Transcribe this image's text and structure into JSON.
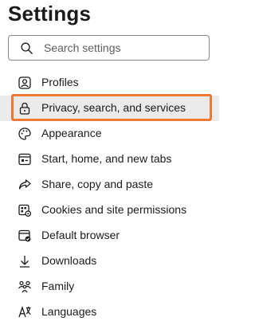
{
  "title": "Settings",
  "search": {
    "placeholder": "Search settings",
    "value": ""
  },
  "nav_items": [
    {
      "label": "Profiles",
      "icon": "profile-icon"
    },
    {
      "label": "Privacy, search, and services",
      "icon": "lock-icon",
      "active": true
    },
    {
      "label": "Appearance",
      "icon": "palette-icon"
    },
    {
      "label": "Start, home, and new tabs",
      "icon": "window-icon"
    },
    {
      "label": "Share, copy and paste",
      "icon": "share-icon"
    },
    {
      "label": "Cookies and site permissions",
      "icon": "cookies-permissions-icon"
    },
    {
      "label": "Default browser",
      "icon": "browser-icon"
    },
    {
      "label": "Downloads",
      "icon": "download-icon"
    },
    {
      "label": "Family",
      "icon": "family-icon"
    },
    {
      "label": "Languages",
      "icon": "language-icon"
    }
  ],
  "colors": {
    "highlight_outline": "#ee7a35",
    "active_background": "#ebebeb"
  }
}
